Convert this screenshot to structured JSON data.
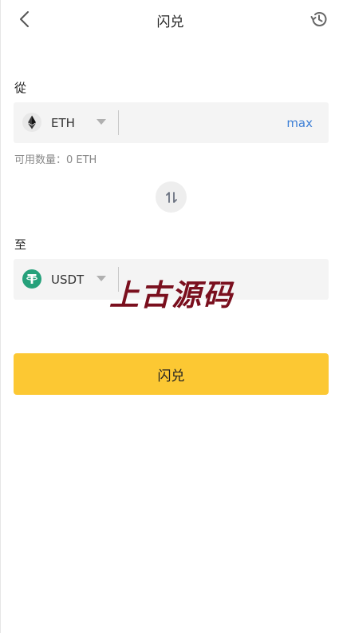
{
  "header": {
    "title": "闪兑",
    "back_icon": "chevron-left-icon",
    "history_icon": "history-icon"
  },
  "from": {
    "label": "從",
    "token": "ETH",
    "amount_value": "",
    "max_label": "max",
    "available_text": "可用数量：0 ETH"
  },
  "to": {
    "label": "至",
    "token": "USDT",
    "amount_value": ""
  },
  "watermark": "上古源码",
  "submit_label": "闪兑",
  "colors": {
    "accent_button": "#fcc833",
    "max_link": "#3d7fd6",
    "usdt_green": "#26a17b",
    "watermark": "#7a0f1e"
  }
}
